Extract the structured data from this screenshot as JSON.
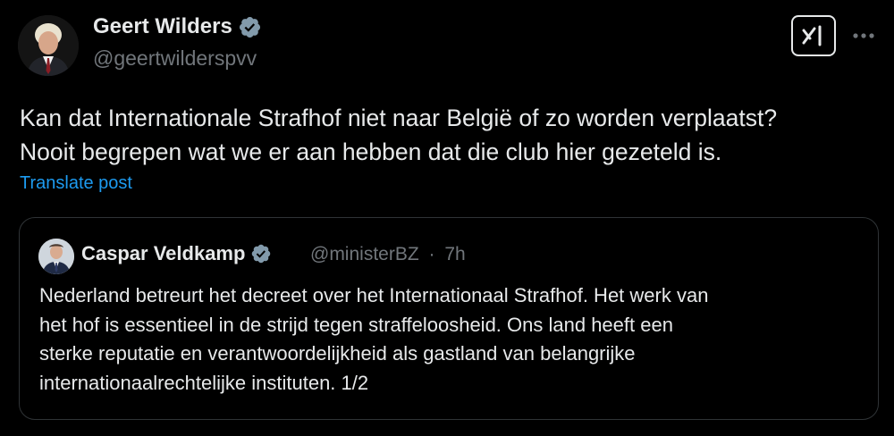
{
  "post": {
    "author": {
      "name": "Geert Wilders",
      "handle": "@geertwilderspvv",
      "avatar_icon": "profile-photo"
    },
    "text_lines": [
      "Kan dat Internationale Strafhof niet naar België of zo worden verplaatst?",
      "Nooit begrepen wat we er aan hebben dat die club hier gezeteld is."
    ],
    "translate_label": "Translate post",
    "actions": {
      "grok_icon": "grok-icon",
      "more_icon": "more-options-icon"
    }
  },
  "quoted": {
    "author": {
      "name": "Caspar Veldkamp",
      "handle": "@ministerBZ",
      "separator": "·",
      "time": "7h"
    },
    "text_lines": [
      "Nederland betreurt het decreet over het Internationaal Strafhof. Het werk van",
      "het hof is essentieel in de strijd tegen straffeloosheid. Ons land heeft een",
      "sterke reputatie en verantwoordelijkheid als gastland van belangrijke",
      "internationaalrechtelijke instituten. 1/2"
    ]
  },
  "colors": {
    "background": "#000000",
    "text": "#e7e9ea",
    "muted": "#71767b",
    "link": "#1d9bf0",
    "border": "#2f3336",
    "verified_badge": "#829aab"
  }
}
